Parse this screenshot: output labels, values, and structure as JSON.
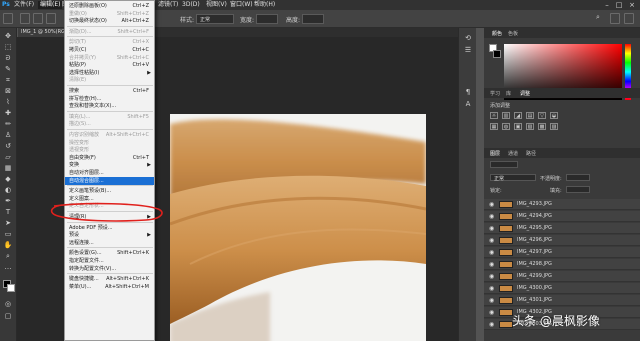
{
  "menubar": {
    "items": [
      "文件(F)",
      "编辑(E)",
      "图像(I)",
      "图层(L)",
      "文字(Y)",
      "选择(S)",
      "滤镜(T)",
      "3D(D)",
      "视图(V)",
      "窗口(W)",
      "帮助(H)"
    ],
    "active": "编辑(E)"
  },
  "optbar": {
    "style_label": "样式:",
    "style_value": "正常",
    "width_label": "宽度:",
    "height_label": "高度:"
  },
  "document": {
    "tab_title": "IMG_1 @ 50%(RGB/8)"
  },
  "edit_menu": {
    "items": [
      {
        "label": "还原删除画板(O)",
        "shortcut": "Ctrl+Z",
        "disabled": false
      },
      {
        "label": "重做(O)",
        "shortcut": "Shift+Ctrl+Z",
        "disabled": true
      },
      {
        "label": "切换最终状态(O)",
        "shortcut": "Alt+Ctrl+Z",
        "disabled": false
      },
      {
        "sep": true
      },
      {
        "label": "渐隐(D)...",
        "shortcut": "Shift+Ctrl+F",
        "disabled": true
      },
      {
        "sep": true
      },
      {
        "label": "剪切(T)",
        "shortcut": "Ctrl+X",
        "disabled": true
      },
      {
        "label": "拷贝(C)",
        "shortcut": "Ctrl+C",
        "disabled": false
      },
      {
        "label": "合并拷贝(Y)",
        "shortcut": "Shift+Ctrl+C",
        "disabled": true
      },
      {
        "label": "粘贴(P)",
        "shortcut": "Ctrl+V",
        "disabled": false
      },
      {
        "label": "选择性粘贴(I)",
        "shortcut": "",
        "disabled": false,
        "submenu": true
      },
      {
        "label": "清除(E)",
        "shortcut": "",
        "disabled": true
      },
      {
        "sep": true
      },
      {
        "label": "搜索",
        "shortcut": "Ctrl+F",
        "disabled": false
      },
      {
        "label": "拼写检查(H)...",
        "shortcut": "",
        "disabled": false
      },
      {
        "label": "查找和替换文本(X)...",
        "shortcut": "",
        "disabled": false
      },
      {
        "sep": true
      },
      {
        "label": "填充(L)...",
        "shortcut": "Shift+F5",
        "disabled": true
      },
      {
        "label": "描边(S)...",
        "shortcut": "",
        "disabled": true
      },
      {
        "sep": true
      },
      {
        "label": "内容识别缩放",
        "shortcut": "Alt+Shift+Ctrl+C",
        "disabled": true
      },
      {
        "label": "操控变形",
        "shortcut": "",
        "disabled": true
      },
      {
        "label": "透视变形",
        "shortcut": "",
        "disabled": true
      },
      {
        "label": "自由变换(F)",
        "shortcut": "Ctrl+T",
        "disabled": false
      },
      {
        "label": "变换",
        "shortcut": "",
        "disabled": false,
        "submenu": true
      },
      {
        "label": "自动对齐图层...",
        "shortcut": "",
        "disabled": false
      },
      {
        "label": "自动混合图层...",
        "shortcut": "",
        "disabled": false,
        "highlighted": true
      },
      {
        "sep": true
      },
      {
        "label": "定义画笔预设(B)...",
        "shortcut": "",
        "disabled": false
      },
      {
        "label": "定义图案...",
        "shortcut": "",
        "disabled": false
      },
      {
        "label": "定义自定形状...",
        "shortcut": "",
        "disabled": true
      },
      {
        "sep": true
      },
      {
        "label": "清理(R)",
        "shortcut": "",
        "disabled": false,
        "submenu": true
      },
      {
        "sep": true
      },
      {
        "label": "Adobe PDF 预设...",
        "shortcut": "",
        "disabled": false
      },
      {
        "label": "预设",
        "shortcut": "",
        "disabled": false,
        "submenu": true
      },
      {
        "label": "远程连接...",
        "shortcut": "",
        "disabled": false
      },
      {
        "sep": true
      },
      {
        "label": "颜色设置(G)...",
        "shortcut": "Shift+Ctrl+K",
        "disabled": false
      },
      {
        "label": "指定配置文件...",
        "shortcut": "",
        "disabled": false
      },
      {
        "label": "转换为配置文件(V)...",
        "shortcut": "",
        "disabled": false
      },
      {
        "sep": true
      },
      {
        "label": "键盘快捷键...",
        "shortcut": "Alt+Shift+Ctrl+K",
        "disabled": false
      },
      {
        "label": "菜单(U)...",
        "shortcut": "Alt+Shift+Ctrl+M",
        "disabled": false
      }
    ]
  },
  "panels": {
    "color_tabs": [
      "颜色",
      "色板"
    ],
    "adjust_tabs": [
      "学习",
      "库",
      "调整"
    ],
    "adjust_title": "添加调整",
    "layers_tabs": [
      "图层",
      "通道",
      "路径"
    ],
    "blend_mode": "正常",
    "opacity_label": "不透明度:",
    "lock_label": "锁定:",
    "fill_label": "填充:",
    "layers": [
      "IMG_4293.JPG",
      "IMG_4294.JPG",
      "IMG_4295.JPG",
      "IMG_4296.JPG",
      "IMG_4297.JPG",
      "IMG_4298.JPG",
      "IMG_4299.JPG",
      "IMG_4300.JPG",
      "IMG_4301.JPG",
      "IMG_4302.JPG",
      "IMG_4303.JPG"
    ]
  },
  "watermark": "头条 @晨枫影像",
  "colors": {
    "menu_highlight": "#1a6fd4",
    "annotation": "#e0201c",
    "fabric": "#c98a44"
  }
}
